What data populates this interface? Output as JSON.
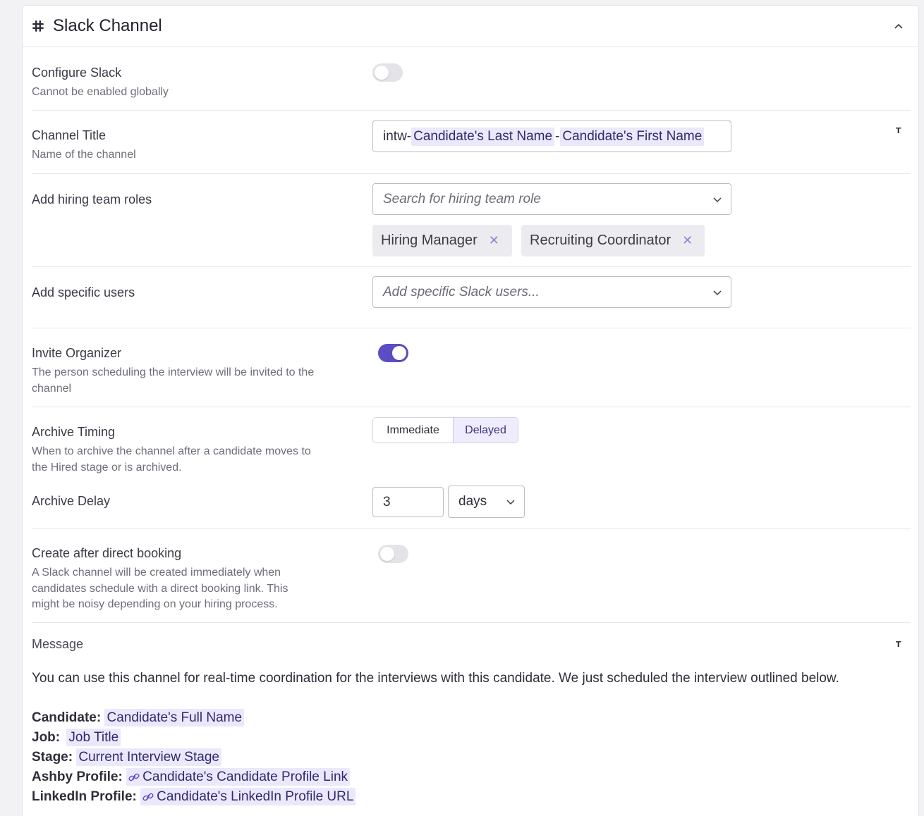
{
  "section": {
    "title": "Slack Channel",
    "icon": "slack-icon",
    "collapse_icon": "chevron-up-icon"
  },
  "configure_slack": {
    "label": "Configure Slack",
    "description": "Cannot be enabled globally",
    "enabled": false
  },
  "channel_title": {
    "label": "Channel Title",
    "description": "Name of the channel",
    "prefix": "intw-",
    "token1": "Candidate's Last Name",
    "separator": "-",
    "token2": "Candidate's First Name",
    "format_icon": "T"
  },
  "hiring_roles": {
    "label": "Add hiring team roles",
    "placeholder": "Search for hiring team role",
    "selected": [
      "Hiring Manager",
      "Recruiting Coordinator"
    ],
    "remove_glyph": "✕"
  },
  "specific_users": {
    "label": "Add specific users",
    "placeholder": "Add specific Slack users..."
  },
  "invite_organizer": {
    "label": "Invite Organizer",
    "description": "The person scheduling the interview will be invited to the channel",
    "enabled": true
  },
  "archive_timing": {
    "label": "Archive Timing",
    "description": "When to archive the channel after a candidate moves to the Hired stage or is archived.",
    "options": [
      "Immediate",
      "Delayed"
    ],
    "selected": "Delayed"
  },
  "archive_delay": {
    "label": "Archive Delay",
    "value": "3",
    "unit": "days"
  },
  "direct_booking": {
    "label": "Create after direct booking",
    "description": "A Slack channel will be created immediately when candidates schedule with a direct booking link. This might be noisy depending on your hiring process.",
    "enabled": false
  },
  "message": {
    "label": "Message",
    "format_icon": "T",
    "intro": "You can use this channel for real-time coordination for the interviews with this candidate. We just scheduled the interview outlined below.",
    "fields": [
      {
        "key": "Candidate:",
        "token": "Candidate's Full Name",
        "link": false
      },
      {
        "key": "Job:",
        "token": "Job Title",
        "link": false
      },
      {
        "key": "Stage:",
        "token": "Current Interview Stage",
        "link": false
      },
      {
        "key": "Ashby Profile:",
        "token": "Candidate's Candidate Profile Link",
        "link": true
      },
      {
        "key": "LinkedIn Profile:",
        "token": "Candidate's LinkedIn Profile URL",
        "link": true
      }
    ]
  },
  "colors": {
    "accent": "#5b4dc4",
    "token_bg": "#ebe8fb",
    "border": "#e6e6ec"
  }
}
